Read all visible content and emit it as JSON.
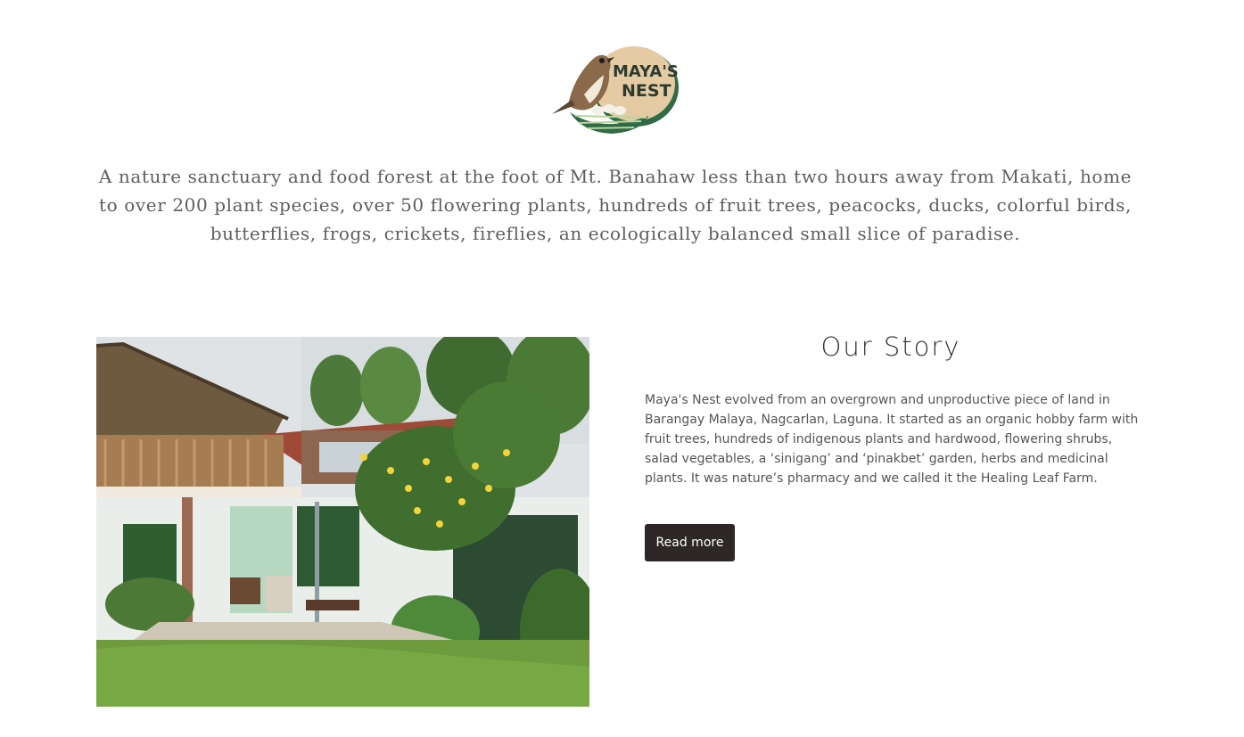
{
  "logo": {
    "line1": "MAYA'S",
    "line2": "NEST",
    "icon": "sparrow-on-nest-logo"
  },
  "tagline": "A nature sanctuary and food forest at the foot of Mt. Banahaw less than two hours away from Makati, home to over 200 plant species, over 50 flowering plants, hundreds of fruit trees, peacocks, ducks, colorful birds, butterflies, frogs, crickets, fireflies, an ecologically balanced small slice of paradise.",
  "story": {
    "title": "Our Story",
    "body": "Maya's Nest evolved from an overgrown and unproductive piece of land in Barangay Malaya, Nagcarlan, Laguna. It started as an organic hobby farm with fruit trees, hundreds of indigenous plants and hardwood, flowering shrubs, salad vegetables, a ‘sinigang’ and ‘pinakbet’ garden, herbs and medicinal plants. It was nature’s pharmacy and we called it the Healing Leaf Farm.",
    "button_label": "Read more"
  },
  "photo": {
    "subject": "house-with-garden-photo"
  },
  "colors": {
    "button_bg": "#2d2727",
    "tagline_text": "#5e5e5e",
    "logo_oval": "#e5cba4",
    "logo_green": "#2f6b45"
  }
}
